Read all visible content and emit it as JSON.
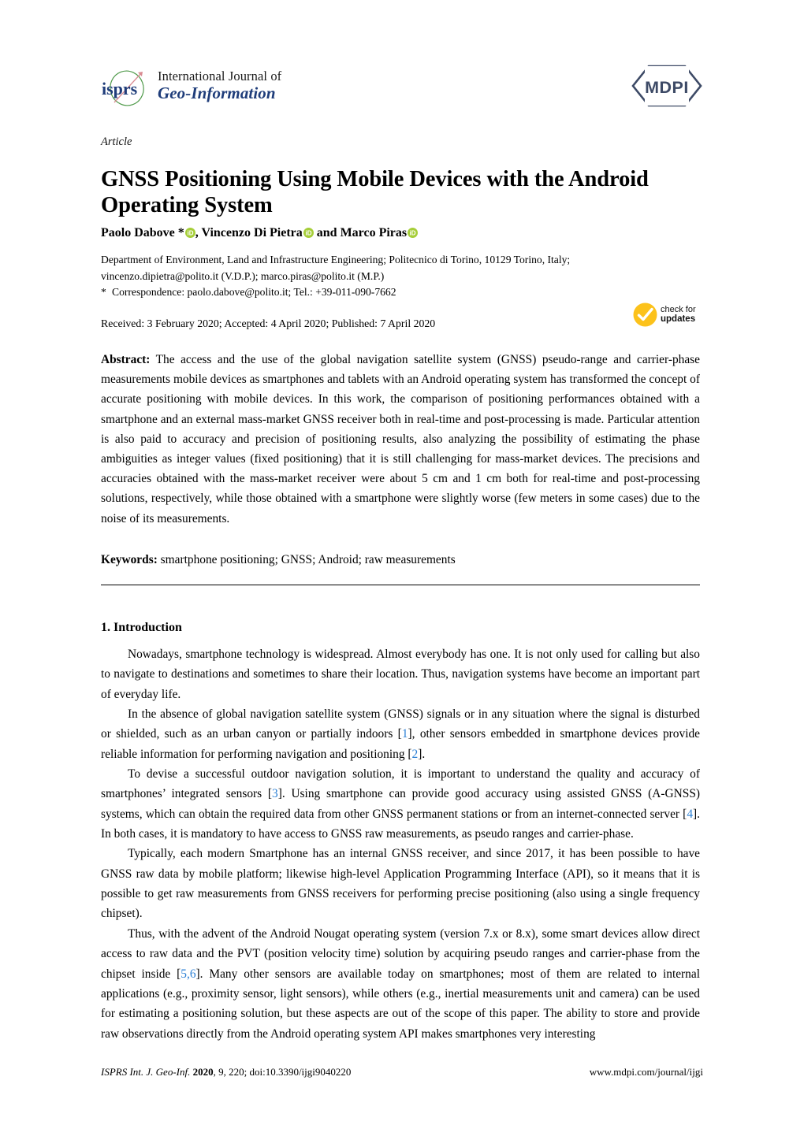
{
  "masthead": {
    "journal_line1": "International Journal of",
    "journal_line2": "Geo-Information",
    "isprs_logo_text": "isprs",
    "publisher_logo_text": "MDPI",
    "brand_color": "#1f3d7a",
    "orcid_color": "#a6ce39",
    "crossmark_color": "#fcc21b",
    "citation_link_color": "#2a7fd4"
  },
  "article": {
    "type_label": "Article",
    "title": "GNSS Positioning Using Mobile Devices with the Android Operating System",
    "authors_html": "Paolo Dabove *[ORCID], Vincenzo Di Pietra[ORCID] and Marco Piras[ORCID]",
    "authors_parts": {
      "a1": "Paolo Dabove *",
      "sep1": ", ",
      "a2": "Vincenzo Di Pietra",
      "sep2": " and ",
      "a3": "Marco Piras"
    },
    "affiliation_line1": "Department of Environment, Land and Infrastructure Engineering; Politecnico di Torino, 10129 Torino, Italy;",
    "affiliation_line2": "vincenzo.dipietra@polito.it (V.D.P.); marco.piras@polito.it (M.P.)",
    "correspondence_marker": "*",
    "correspondence_line": "Correspondence: paolo.dabove@polito.it; Tel.: +39-011-090-7662",
    "dates_line": "Received: 3 February 2020; Accepted: 4 April 2020; Published: 7 April 2020",
    "crossmark_line1": "check for",
    "crossmark_line2": "updates"
  },
  "abstract": {
    "label": "Abstract:",
    "text": " The access and the use of the global navigation satellite system (GNSS) pseudo-range and carrier-phase measurements mobile devices as smartphones and tablets with an Android operating system has transformed the concept of accurate positioning with mobile devices. In this work, the comparison of positioning performances obtained with a smartphone and an external mass-market GNSS receiver both in real-time and post-processing is made. Particular attention is also paid to accuracy and precision of positioning results, also analyzing the possibility of estimating the phase ambiguities as integer values (fixed positioning) that it is still challenging for mass-market devices. The precisions and accuracies obtained with the mass-market receiver were about 5 cm and 1 cm both for real-time and post-processing solutions, respectively, while those obtained with a smartphone were slightly worse (few meters in some cases) due to the noise of its measurements."
  },
  "keywords": {
    "label": "Keywords:",
    "text": " smartphone positioning; GNSS; Android; raw measurements"
  },
  "introduction": {
    "heading": "1. Introduction",
    "paragraphs": [
      {
        "segments": [
          {
            "t": "Nowadays, smartphone technology is widespread. Almost everybody has one. It is not only used for calling but also to navigate to destinations and sometimes to share their location. Thus, navigation systems have become an important part of everyday life."
          }
        ]
      },
      {
        "segments": [
          {
            "t": "In the absence of global navigation satellite system (GNSS) signals or in any situation where the signal is disturbed or shielded, such as an urban canyon or partially indoors ["
          },
          {
            "t": "1",
            "cite": true
          },
          {
            "t": "], other sensors embedded in smartphone devices provide reliable information for performing navigation and positioning ["
          },
          {
            "t": "2",
            "cite": true
          },
          {
            "t": "]."
          }
        ]
      },
      {
        "segments": [
          {
            "t": "To devise a successful outdoor navigation solution, it is important to understand the quality and accuracy of smartphones’ integrated sensors ["
          },
          {
            "t": "3",
            "cite": true
          },
          {
            "t": "]. Using smartphone can provide good accuracy using assisted GNSS (A-GNSS) systems, which can obtain the required data from other GNSS permanent stations or from an internet-connected server ["
          },
          {
            "t": "4",
            "cite": true
          },
          {
            "t": "]. In both cases, it is mandatory to have access to GNSS raw measurements, as pseudo ranges and carrier-phase."
          }
        ]
      },
      {
        "segments": [
          {
            "t": "Typically, each modern Smartphone has an internal GNSS receiver, and since 2017, it has been possible to have GNSS raw data by mobile platform; likewise high-level Application Programming Interface (API), so it means that it is possible to get raw measurements from GNSS receivers for performing precise positioning (also using a single frequency chipset)."
          }
        ]
      },
      {
        "segments": [
          {
            "t": "Thus, with the advent of the Android Nougat operating system (version 7.x or 8.x), some smart devices allow direct access to raw data and the PVT (position velocity time) solution by acquiring pseudo ranges and carrier-phase from the chipset inside ["
          },
          {
            "t": "5,6",
            "cite": true
          },
          {
            "t": "]. Many other sensors are available today on smartphones; most of them are related to internal applications (e.g., proximity sensor, light sensors), while others (e.g., inertial measurements unit and camera) can be used for estimating a positioning solution, but these aspects are out of the scope of this paper. The ability to store and provide raw observations directly from the Android operating system API makes smartphones very interesting"
          }
        ]
      }
    ]
  },
  "footer": {
    "journal_abbrev": "ISPRS Int. J. Geo-Inf.",
    "year": "2020",
    "volume_issue": ", 9, 220; doi:10.3390/ijgi9040220",
    "website": "www.mdpi.com/journal/ijgi"
  }
}
